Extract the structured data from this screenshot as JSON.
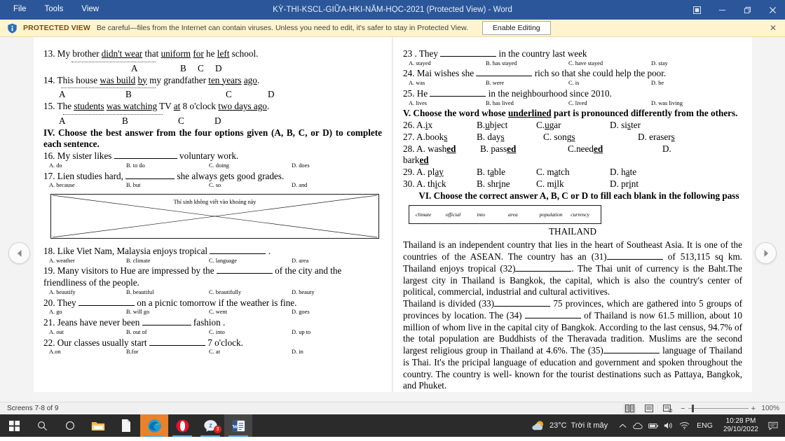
{
  "window": {
    "title": "KỲ-THI-KSCL-GIỮA-HKI-NĂM-HỌC-2021 (Protected View) - Word",
    "menus": [
      {
        "label": "File"
      },
      {
        "label": "Tools"
      },
      {
        "label": "View"
      }
    ],
    "controls": {
      "ribbon_display": "ribbon-display-options",
      "minimize": "minimize",
      "restore": "restore",
      "close": "close"
    }
  },
  "protected_view": {
    "icon": "shield-icon",
    "label": "PROTECTED VIEW",
    "message": "Be careful—files from the Internet can contain viruses. Unless you need to edit, it's safer to stay in Protected View.",
    "button": "Enable Editing",
    "close": "✕"
  },
  "navigation": {
    "prev": "previous-page",
    "next": "next-page"
  },
  "left_page": {
    "q13": {
      "num": "13.",
      "parts": [
        "My brother ",
        "didn't wear",
        " that ",
        "uniform",
        "   ",
        "for",
        "   he  ",
        "left",
        " school."
      ],
      "labels": [
        "A",
        "B",
        "C",
        "D"
      ]
    },
    "q14": {
      "num": "14.",
      "text_a": "This house ",
      "u1": "was build",
      "text_b": "   ",
      "u2": "by",
      "text_c": " my grandfather  ",
      "u3": "ten years",
      "text_d": "   ",
      "u4": "ago",
      "text_e": ".",
      "labels": [
        "A",
        "B",
        "C",
        "D"
      ]
    },
    "q15": {
      "num": "15.",
      "text_a": "The ",
      "u1": "students",
      "u2": "was watching",
      "text_b": " TV ",
      "u3": "at",
      "text_c": " 8 o'clock ",
      "u4": "two days ago",
      "text_d": ".",
      "labels": [
        "A",
        "B",
        "C",
        "D"
      ]
    },
    "section4": "IV. Choose the best answer from the four options given (A, B, C, or D) to complete each sentence.",
    "questions": [
      {
        "num": "16.",
        "before": "My sister likes",
        "after": "voluntary work.",
        "options": [
          "A. do",
          "B. to do",
          "C. doing",
          "D. does"
        ]
      },
      {
        "num": "17.",
        "before": "Lien studies hard,",
        "after": "she always gets good grades.",
        "options": [
          "A. because",
          "B. but",
          "C. so",
          "D. and"
        ]
      },
      {
        "num": "18.",
        "before": "Like Viet Nam, Malaysia enjoys tropical",
        "after": ".",
        "options": [
          "A. weather",
          "B. climate",
          "C. language",
          "D. area"
        ]
      },
      {
        "num": "19.",
        "before": "Many visitors to Hue are impressed by the",
        "after": "of the city and the friendliness of the people.",
        "options": [
          "A. beautify",
          "B. beautiful",
          "C. beautifully",
          "D. beauty"
        ]
      },
      {
        "num": "20.",
        "before": "They",
        "after": "on a picnic tomorrow if the weather is fine.",
        "options": [
          "A. go",
          "B. will go",
          "C. went",
          "D. goes"
        ]
      },
      {
        "num": "21.",
        "before": "Jeans have never been",
        "after": "fashion .",
        "options": [
          "A. out",
          "B. out of",
          "C. into",
          "D. up to"
        ]
      },
      {
        "num": "22.",
        "before": "Our classes usually start",
        "after": "7 o'clock.",
        "options": [
          "A.on",
          "B.for",
          "C. at",
          "D. in"
        ]
      }
    ],
    "crossbox_caption": "Thí sinh không viết vào khoảng này"
  },
  "right_page": {
    "questions": [
      {
        "num": "23 .",
        "before": "They",
        "after": "in the country last week",
        "options": [
          "A. stayed",
          "B. has stayed",
          "C. have stayed",
          "D. stay"
        ]
      },
      {
        "num": "24.",
        "before": "Mai wishes she",
        "after": "rich so that she could help the poor.",
        "options": [
          "A. was",
          "B. were",
          "C. is",
          "D. be"
        ]
      },
      {
        "num": "25.",
        "before": "He",
        "after": "in the neighbourhood since 2010.",
        "options": [
          "A. lives",
          "B. has lived",
          "C. lived",
          "D. was living"
        ]
      }
    ],
    "section5": {
      "prefix": "V. Choose the word whose ",
      "underlined": "underlined",
      "suffix": " part is pronounced differently from the others."
    },
    "pron": [
      {
        "num": "26. A. ",
        "a": {
          "pre": "s",
          "u": "i",
          "post": "x"
        },
        "b": {
          "lead": "B. ",
          "pre": "s",
          "u": "u",
          "post": "bject"
        },
        "c": {
          "lead": "C. ",
          "pre": "s",
          "u": "u",
          "post": "gar"
        },
        "d": {
          "lead": "D. si",
          "pre": "",
          "u": "s",
          "post": "ter"
        }
      },
      {
        "num": "27. A. ",
        "a": {
          "pre": "book",
          "u": "s",
          "post": ""
        },
        "b": {
          "lead": "B. day",
          "pre": "",
          "u": "s",
          "post": ""
        },
        "c": {
          "lead": "C. song",
          "pre": "",
          "u": "s",
          "post": ""
        },
        "d": {
          "lead": "D. eraser",
          "pre": "",
          "u": "s",
          "post": ""
        }
      },
      {
        "num": "28. A. wash",
        "a": {
          "pre": "",
          "u": "ed",
          "post": ""
        },
        "b": {
          "lead": "B. pass",
          "pre": "",
          "u": "ed",
          "post": ""
        },
        "c": {
          "lead": "C.need",
          "pre": "",
          "u": "ed",
          "post": ""
        },
        "d": {
          "lead": "D.",
          "pre": "",
          "u": "",
          "post": ""
        }
      },
      {
        "num": "29. A. pl",
        "a": {
          "pre": "",
          "u": "ay",
          "post": ""
        },
        "b": {
          "lead": "B. t",
          "pre": "",
          "u": "a",
          "post": "ble"
        },
        "c": {
          "lead": "C. m",
          "pre": "",
          "u": "a",
          "post": "tch"
        },
        "d": {
          "lead": "D. h",
          "pre": "",
          "u": "a",
          "post": "te"
        }
      },
      {
        "num": "30. A. th",
        "a": {
          "pre": "",
          "u": "i",
          "post": "ck"
        },
        "b": {
          "lead": "B. shr",
          "pre": "",
          "u": "i",
          "post": "ne"
        },
        "c": {
          "lead": "C. m",
          "pre": "",
          "u": "i",
          "post": "lk"
        },
        "d": {
          "lead": "D. pr",
          "pre": "",
          "u": "i",
          "post": "nt"
        }
      }
    ],
    "q28_wrap": "bark",
    "q28_wrap_u": "ed",
    "section6": "VI. Choose the correct answer A, B, C or D to fill each blank in the following pass",
    "wordbank": [
      "climate",
      "official",
      "into",
      "area",
      "population",
      "currency"
    ],
    "passage_title": "THAILAND",
    "passage_p1_a": "Thailand is an independent country that lies in the heart of Southeast Asia. It is one of the countries of the ASEAN. The country has an (31)",
    "passage_p1_b": "of 513,115 sq km. Thailand enjoys tropical (32)",
    "passage_p1_c": ". The Thai unit of currency is the Baht.The largest city in Thailand is Bangkok, the capital, which is also the country's center of political, commercial, industrial and cultural activitives.",
    "passage_p2_a": "Thailand is divided (33)",
    "passage_p2_b": "75 provinces, which are gathered into 5 groups of provinces by location. The (34)",
    "passage_p2_c": "of Thailand is now 61.5 million, about 10 million of whom live in the capital city of  Bangkok. According to the last census, 94.7% of the total population are Buddhists of the Theravada tradition. Muslims are the second largest religious group in Thailand at 4.6%. The (35)",
    "passage_p2_d": "language of Thailand is Thai. It's the pricipal language of education and government and spoken throughout the country. The country is well- known for the tourist destinations such as Pattaya, Bangkok, and Phuket."
  },
  "status_bar": {
    "screens": "Screens 7-8 of 9",
    "views": [
      {
        "name": "read-mode",
        "active": true
      },
      {
        "name": "print-layout",
        "active": false
      },
      {
        "name": "web-layout",
        "active": false
      }
    ],
    "zoom_out": "−",
    "zoom_in": "+",
    "zoom_level": "100%"
  },
  "taskbar": {
    "items": [
      {
        "name": "start-button",
        "icon": "windows-logo"
      },
      {
        "name": "search",
        "icon": "search-icon"
      },
      {
        "name": "cortana",
        "icon": "circle-icon"
      },
      {
        "name": "file-explorer",
        "icon": "folder-icon"
      },
      {
        "name": "document-app",
        "icon": "document-icon"
      },
      {
        "name": "microsoft-edge",
        "icon": "edge-icon",
        "badge": ""
      },
      {
        "name": "opera",
        "icon": "opera-icon",
        "badge": ""
      },
      {
        "name": "zalo",
        "icon": "zalo-icon",
        "badge": "3"
      },
      {
        "name": "word",
        "icon": "word-icon",
        "badge": ""
      }
    ],
    "weather": {
      "icon": "partly-cloudy-icon",
      "temp": "23°C",
      "desc": "Trời ít mây"
    },
    "tray": {
      "chevron": "show-hidden-icons",
      "onedrive": "onedrive-icon",
      "battery": "battery-icon",
      "volume": "volume-icon",
      "network": "wifi-icon",
      "language": "ENG",
      "time": "10:28 PM",
      "date": "29/10/2022",
      "notifications": "action-center-icon"
    }
  }
}
